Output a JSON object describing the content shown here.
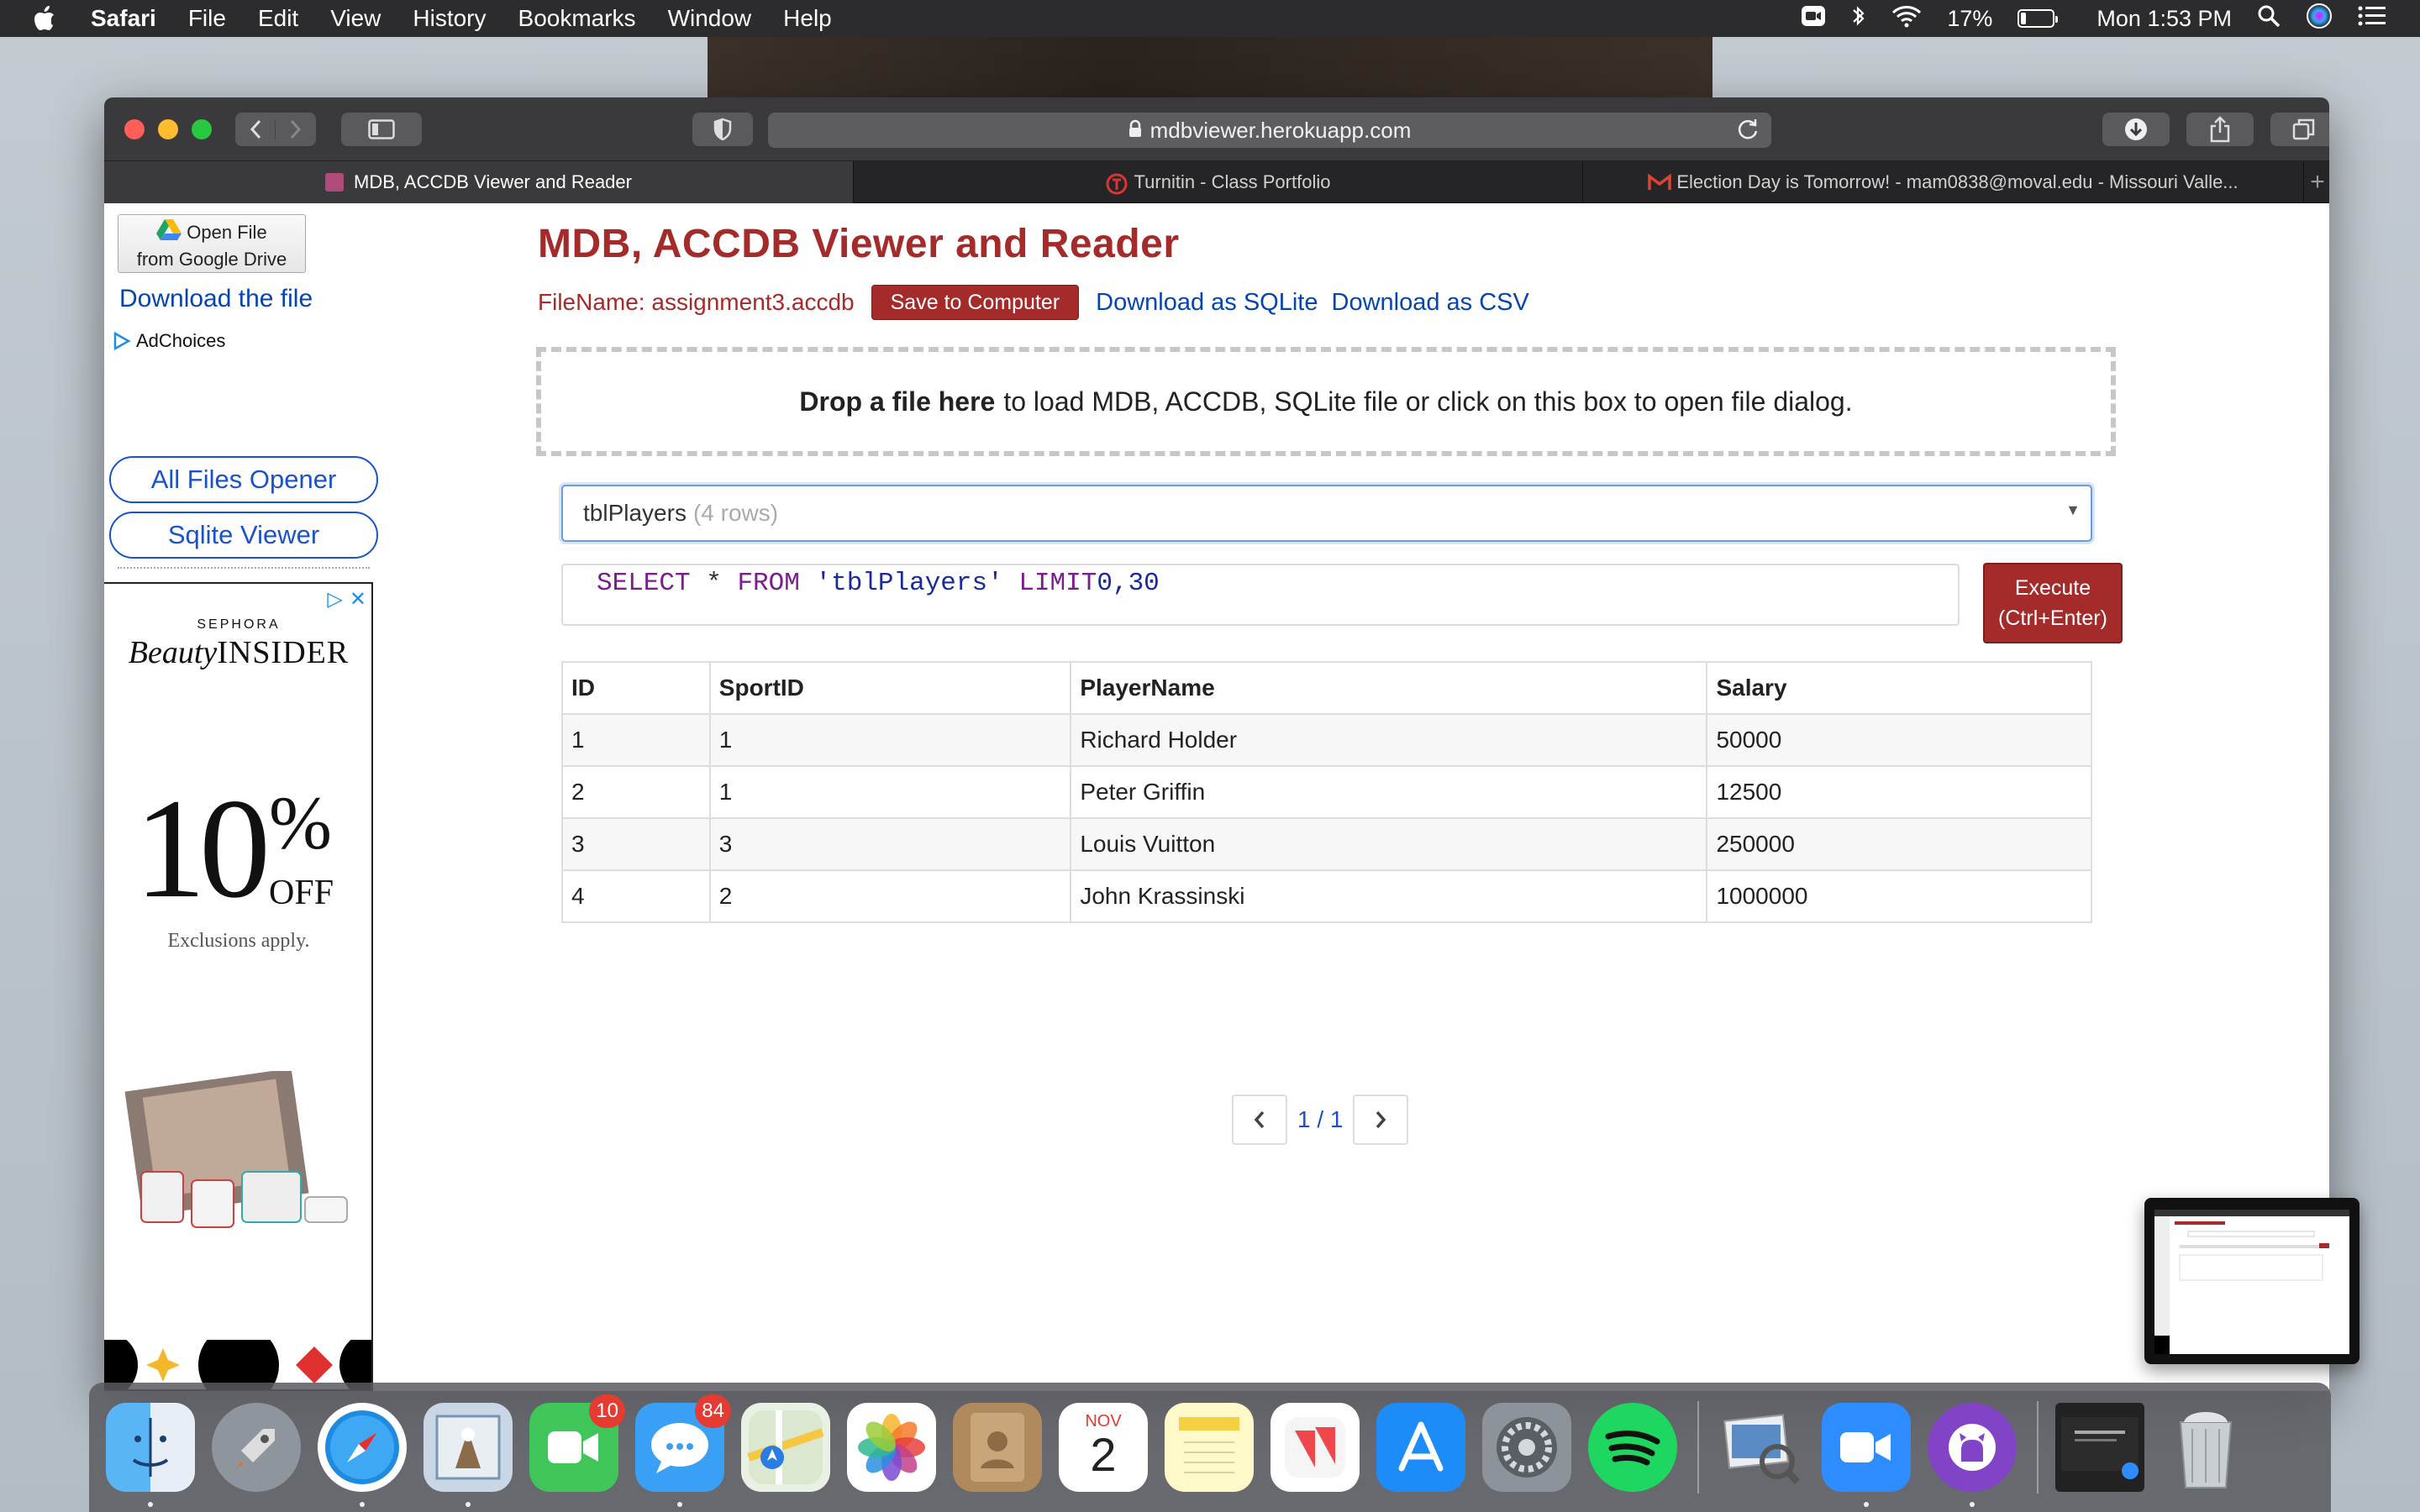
{
  "menubar": {
    "app_name": "Safari",
    "items": [
      "File",
      "Edit",
      "View",
      "History",
      "Bookmarks",
      "Window",
      "Help"
    ],
    "battery_percent": "17%",
    "battery_level": 0.17,
    "clock": "Mon 1:53 PM"
  },
  "browser": {
    "url": "mdbviewer.herokuapp.com",
    "tabs": [
      {
        "title": "MDB, ACCDB Viewer and Reader",
        "active": true
      },
      {
        "title": "Turnitin - Class Portfolio",
        "active": false
      },
      {
        "title": "Election Day is Tomorrow! - mam0838@moval.edu - Missouri Valle...",
        "active": false
      }
    ]
  },
  "sidebar": {
    "gdrive_line1": "Open File",
    "gdrive_line2": "from Google Drive",
    "download_link": "Download the file",
    "adchoices": "AdChoices",
    "all_files_opener": "All Files Opener",
    "sqlite_viewer": "Sqlite Viewer",
    "ad": {
      "brand_top": "SEPHORA",
      "brand_word1": "Beauty",
      "brand_word2": "INSIDER",
      "discount_number": "10",
      "discount_percent": "%",
      "discount_off": "OFF",
      "exclusions": "Exclusions apply."
    }
  },
  "main": {
    "title": "MDB, ACCDB Viewer and Reader",
    "filename": "FileName: assignment3.accdb",
    "save_button": "Save to Computer",
    "download_sqlite": "Download as SQLite",
    "download_csv": "Download as CSV",
    "dropzone_bold": "Drop a file here",
    "dropzone_rest": "to load MDB, ACCDB, SQLite file or click on this box to open file dialog.",
    "table_select": "tblPlayers",
    "table_rows": "(4 rows)",
    "sql": {
      "select": "SELECT",
      "star": "*",
      "from": "FROM",
      "table": "'tblPlayers'",
      "limit": "LIMIT",
      "range": "0,30"
    },
    "execute_line1": "Execute",
    "execute_line2": "(Ctrl+Enter)",
    "table": {
      "headers": [
        "ID",
        "SportID",
        "PlayerName",
        "Salary"
      ],
      "rows": [
        [
          "1",
          "1",
          "Richard Holder",
          "50000"
        ],
        [
          "2",
          "1",
          "Peter Griffin",
          "12500"
        ],
        [
          "3",
          "3",
          "Louis Vuitton",
          "250000"
        ],
        [
          "4",
          "2",
          "John Krassinski",
          "1000000"
        ]
      ]
    },
    "pager": "1 / 1"
  },
  "dock": {
    "facetime_badge": "10",
    "messages_badge": "84",
    "calendar_month": "NOV",
    "calendar_day": "2"
  },
  "colors": {
    "accent_red": "#a52a2a",
    "link_blue": "#0645ad",
    "pill_blue": "#1a53c9"
  }
}
